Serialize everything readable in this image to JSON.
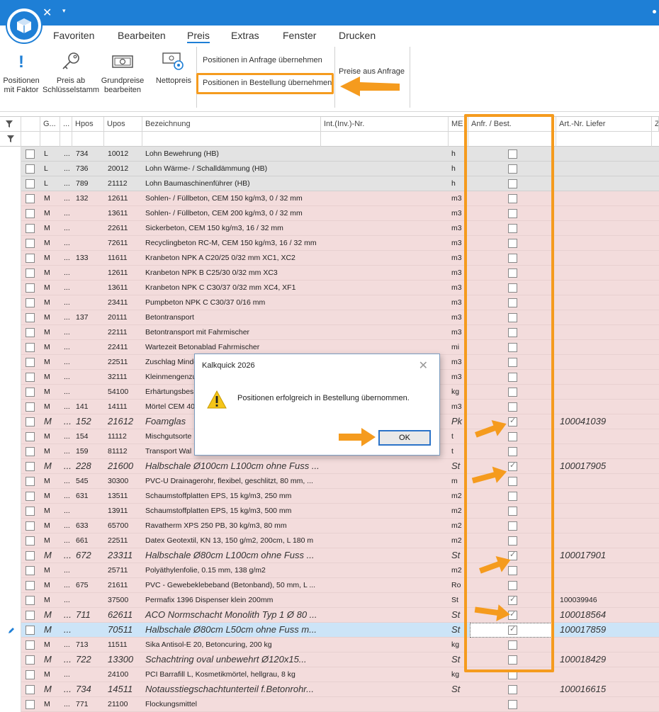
{
  "window": {
    "close_glyph": "✕",
    "dropdown_glyph": "▾"
  },
  "menu": [
    "Favoriten",
    "Bearbeiten",
    "Preis",
    "Extras",
    "Fenster",
    "Drucken"
  ],
  "menu_active": "Preis",
  "ribbon": {
    "positionen_mit_faktor": [
      "Positionen",
      "mit Faktor"
    ],
    "preis_ab_schluessel": [
      "Preis ab",
      "Schlüsselstamm"
    ],
    "grundpreise": [
      "Grundpreise",
      "bearbeiten"
    ],
    "nettopreis": "Nettopreis",
    "anfrage_uebernehmen": "Positionen in Anfrage übernehmen",
    "bestellung_uebernehmen": "Positionen in Bestellung übernehmen",
    "preise_aus_anfrage": "Preise aus Anfrage"
  },
  "columns": {
    "g": "G...",
    "dots": "...",
    "hpos": "Hpos",
    "upos": "Upos",
    "bezeichnung": "Bezeichnung",
    "int": "Int.(Inv.)-Nr.",
    "me": "ME",
    "anfr": "Anfr. / Best.",
    "art": "Art.-Nr. Liefer",
    "z": "Z"
  },
  "rows": [
    {
      "g": "L",
      "d": "...",
      "hpos": "734",
      "upos": "10012",
      "bez": "Lohn Bewehrung (HB)",
      "me": "h",
      "checked": false,
      "art": "",
      "big": false
    },
    {
      "g": "L",
      "d": "...",
      "hpos": "736",
      "upos": "20012",
      "bez": "Lohn Wärme- / Schalldämmung (HB)",
      "me": "h",
      "checked": false,
      "art": "",
      "big": false
    },
    {
      "g": "L",
      "d": "...",
      "hpos": "789",
      "upos": "21112",
      "bez": "Lohn Baumaschinenführer (HB)",
      "me": "h",
      "checked": false,
      "art": "",
      "big": false
    },
    {
      "g": "M",
      "d": "...",
      "hpos": "132",
      "upos": "12611",
      "bez": "Sohlen- / Füllbeton, CEM 150 kg/m3, 0 / 32 mm",
      "me": "m3",
      "checked": false,
      "art": "",
      "big": false
    },
    {
      "g": "M",
      "d": "...",
      "hpos": "",
      "upos": "13611",
      "bez": "Sohlen- / Füllbeton, CEM 200 kg/m3, 0 / 32 mm",
      "me": "m3",
      "checked": false,
      "art": "",
      "big": false
    },
    {
      "g": "M",
      "d": "...",
      "hpos": "",
      "upos": "22611",
      "bez": "Sickerbeton, CEM 150 kg/m3, 16 / 32 mm",
      "me": "m3",
      "checked": false,
      "art": "",
      "big": false
    },
    {
      "g": "M",
      "d": "...",
      "hpos": "",
      "upos": "72611",
      "bez": "Recyclingbeton RC-M, CEM 150 kg/m3, 16 / 32 mm",
      "me": "m3",
      "checked": false,
      "art": "",
      "big": false
    },
    {
      "g": "M",
      "d": "...",
      "hpos": "133",
      "upos": "11611",
      "bez": "Kranbeton  NPK A  C20/25  0/32 mm  XC1, XC2",
      "me": "m3",
      "checked": false,
      "art": "",
      "big": false
    },
    {
      "g": "M",
      "d": "...",
      "hpos": "",
      "upos": "12611",
      "bez": "Kranbeton  NPK B  C25/30  0/32 mm  XC3",
      "me": "m3",
      "checked": false,
      "art": "",
      "big": false
    },
    {
      "g": "M",
      "d": "...",
      "hpos": "",
      "upos": "13611",
      "bez": "Kranbeton  NPK C  C30/37  0/32 mm  XC4, XF1",
      "me": "m3",
      "checked": false,
      "art": "",
      "big": false
    },
    {
      "g": "M",
      "d": "...",
      "hpos": "",
      "upos": "23411",
      "bez": "Pumpbeton  NPK C  C30/37  0/16 mm",
      "me": "m3",
      "checked": false,
      "art": "",
      "big": false
    },
    {
      "g": "M",
      "d": "...",
      "hpos": "137",
      "upos": "20111",
      "bez": "Betontransport",
      "me": "m3",
      "checked": false,
      "art": "",
      "big": false
    },
    {
      "g": "M",
      "d": "...",
      "hpos": "",
      "upos": "22111",
      "bez": "Betontransport mit Fahrmischer",
      "me": "m3",
      "checked": false,
      "art": "",
      "big": false
    },
    {
      "g": "M",
      "d": "...",
      "hpos": "",
      "upos": "22411",
      "bez": "Wartezeit Betonablad Fahrmischer",
      "me": "mi",
      "checked": false,
      "art": "",
      "big": false
    },
    {
      "g": "M",
      "d": "...",
      "hpos": "",
      "upos": "22511",
      "bez": "Zuschlag Minde",
      "me": "m3",
      "checked": false,
      "art": "",
      "big": false
    },
    {
      "g": "M",
      "d": "...",
      "hpos": "",
      "upos": "32111",
      "bez": "Kleinmengenzu",
      "me": "m3",
      "checked": false,
      "art": "",
      "big": false
    },
    {
      "g": "M",
      "d": "...",
      "hpos": "",
      "upos": "54100",
      "bez": "Erhärtungsbes",
      "me": "kg",
      "checked": false,
      "art": "",
      "big": false
    },
    {
      "g": "M",
      "d": "...",
      "hpos": "141",
      "upos": "14111",
      "bez": "Mörtel CEM 40",
      "me": "m3",
      "checked": false,
      "art": "",
      "big": false
    },
    {
      "g": "M",
      "d": "...",
      "hpos": "152",
      "upos": "21612",
      "bez": "Foamglas",
      "me": "Pk",
      "checked": true,
      "art": "100041039",
      "big": true
    },
    {
      "g": "M",
      "d": "...",
      "hpos": "154",
      "upos": "11112",
      "bez": "Mischgutsorte",
      "me": "t",
      "checked": false,
      "art": "",
      "big": false
    },
    {
      "g": "M",
      "d": "...",
      "hpos": "159",
      "upos": "81112",
      "bez": "Transport Wal",
      "me": "t",
      "checked": false,
      "art": "",
      "big": false
    },
    {
      "g": "M",
      "d": "...",
      "hpos": "228",
      "upos": "21600",
      "bez": "Halbschale Ø100cm L100cm ohne Fuss ...",
      "me": "St",
      "checked": true,
      "art": "100017905",
      "big": true
    },
    {
      "g": "M",
      "d": "...",
      "hpos": "545",
      "upos": "30300",
      "bez": "PVC-U Drainagerohr, flexibel, geschlitzt, 80 mm, ...",
      "me": "m",
      "checked": false,
      "art": "",
      "big": false
    },
    {
      "g": "M",
      "d": "...",
      "hpos": "631",
      "upos": "13511",
      "bez": "Schaumstoffplatten EPS, 15 kg/m3, 250 mm",
      "me": "m2",
      "checked": false,
      "art": "",
      "big": false
    },
    {
      "g": "M",
      "d": "...",
      "hpos": "",
      "upos": "13911",
      "bez": "Schaumstoffplatten EPS, 15 kg/m3, 500 mm",
      "me": "m2",
      "checked": false,
      "art": "",
      "big": false
    },
    {
      "g": "M",
      "d": "...",
      "hpos": "633",
      "upos": "65700",
      "bez": "Ravatherm XPS 250 PB, 30 kg/m3, 80 mm",
      "me": "m2",
      "checked": false,
      "art": "",
      "big": false
    },
    {
      "g": "M",
      "d": "...",
      "hpos": "661",
      "upos": "22511",
      "bez": "Datex Geotextil, KN 13, 150 g/m2, 200cm, L 180 m",
      "me": "m2",
      "checked": false,
      "art": "",
      "big": false
    },
    {
      "g": "M",
      "d": "...",
      "hpos": "672",
      "upos": "23311",
      "bez": "Halbschale Ø80cm L100cm ohne Fuss ...",
      "me": "St",
      "checked": true,
      "art": "100017901",
      "big": true
    },
    {
      "g": "M",
      "d": "...",
      "hpos": "",
      "upos": "25711",
      "bez": "Polyäthylenfolie, 0.15 mm, 138 g/m2",
      "me": "m2",
      "checked": false,
      "art": "",
      "big": false
    },
    {
      "g": "M",
      "d": "...",
      "hpos": "675",
      "upos": "21611",
      "bez": "PVC - Gewebeklebeband (Betonband), 50 mm, L ...",
      "me": "Ro",
      "checked": false,
      "art": "",
      "big": false
    },
    {
      "g": "M",
      "d": "...",
      "hpos": "",
      "upos": "37500",
      "bez": "Permafix 1396 Dispenser klein 200mm",
      "me": "St",
      "checked": true,
      "art": "100039946",
      "big": false
    },
    {
      "g": "M",
      "d": "...",
      "hpos": "711",
      "upos": "62611",
      "bez": "ACO Normschacht Monolith Typ 1 Ø 80 ...",
      "me": "St",
      "checked": true,
      "art": "100018564",
      "big": true
    },
    {
      "g": "M",
      "d": "...",
      "hpos": "",
      "upos": "70511",
      "bez": "Halbschale Ø80cm L50cm ohne Fuss m...",
      "me": "St",
      "checked": true,
      "art": "100017859",
      "big": true,
      "selected": true
    },
    {
      "g": "M",
      "d": "...",
      "hpos": "713",
      "upos": "11511",
      "bez": "Sika Antisol-E 20, Betoncuring, 200 kg",
      "me": "kg",
      "checked": false,
      "art": "",
      "big": false
    },
    {
      "g": "M",
      "d": "...",
      "hpos": "722",
      "upos": "13300",
      "bez": "Schachtring oval unbewehrt Ø120x15...",
      "me": "St",
      "checked": false,
      "art": "100018429",
      "big": true
    },
    {
      "g": "M",
      "d": "...",
      "hpos": "",
      "upos": "24100",
      "bez": "PCI Barrafill L, Kosmetikmörtel, hellgrau, 8 kg",
      "me": "kg",
      "checked": false,
      "art": "",
      "big": false
    },
    {
      "g": "M",
      "d": "...",
      "hpos": "734",
      "upos": "14511",
      "bez": "Notausstiegschachtunterteil f.Betonrohr...",
      "me": "St",
      "checked": false,
      "art": "100016615",
      "big": true
    },
    {
      "g": "M",
      "d": "...",
      "hpos": "771",
      "upos": "21100",
      "bez": "Flockungsmittel",
      "me": "",
      "checked": false,
      "art": "",
      "big": false
    }
  ],
  "dialog": {
    "title": "Kalkquick  2026",
    "message": "Positionen erfolgreich in Bestellung übernommen.",
    "ok": "OK",
    "close_glyph": "✕"
  },
  "colors": {
    "accent": "#1e7fd6",
    "highlight": "#f59b1e",
    "row_l": "#e3e3e3",
    "row_m": "#f3dcdc",
    "row_selected": "#cce4f7"
  }
}
